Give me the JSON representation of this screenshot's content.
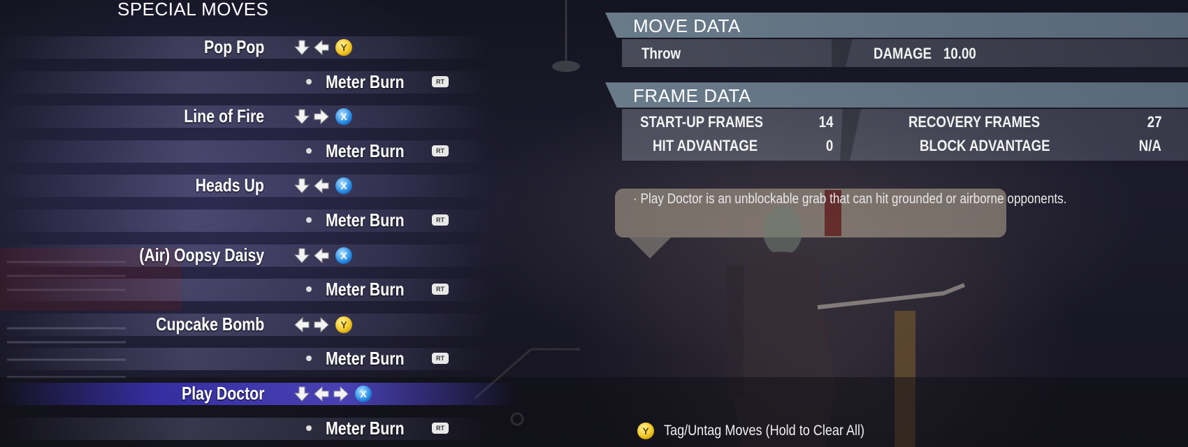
{
  "moves_list": {
    "title": "SPECIAL MOVES",
    "rows": [
      {
        "type": "move",
        "name": "Pop Pop",
        "inputs": [
          "down",
          "back"
        ],
        "button": {
          "label": "Y",
          "color": "#f0c420"
        },
        "selected": false
      },
      {
        "type": "meter",
        "label": "Meter Burn",
        "trigger": "RT"
      },
      {
        "type": "move",
        "name": "Line of Fire",
        "inputs": [
          "down",
          "forward"
        ],
        "button": {
          "label": "X",
          "color": "#2a8ee8"
        },
        "selected": false
      },
      {
        "type": "meter",
        "label": "Meter Burn",
        "trigger": "RT"
      },
      {
        "type": "move",
        "name": "Heads Up",
        "inputs": [
          "down",
          "back"
        ],
        "button": {
          "label": "X",
          "color": "#2a8ee8"
        },
        "selected": false
      },
      {
        "type": "meter",
        "label": "Meter Burn",
        "trigger": "RT"
      },
      {
        "type": "move",
        "name": "(Air) Oopsy Daisy",
        "inputs": [
          "down",
          "back"
        ],
        "button": {
          "label": "X",
          "color": "#2a8ee8"
        },
        "selected": false
      },
      {
        "type": "meter",
        "label": "Meter Burn",
        "trigger": "RT"
      },
      {
        "type": "move",
        "name": "Cupcake Bomb",
        "inputs": [
          "back",
          "forward"
        ],
        "button": {
          "label": "Y",
          "color": "#f0c420"
        },
        "selected": false
      },
      {
        "type": "meter",
        "label": "Meter Burn",
        "trigger": "RT"
      },
      {
        "type": "move",
        "name": "Play Doctor",
        "inputs": [
          "down",
          "back",
          "forward"
        ],
        "button": {
          "label": "X",
          "color": "#2a8ee8"
        },
        "selected": true
      },
      {
        "type": "meter",
        "label": "Meter Burn",
        "trigger": "RT"
      }
    ]
  },
  "move_data": {
    "title": "MOVE DATA",
    "type": "Throw",
    "damage_label": "DAMAGE",
    "damage_value": "10.00"
  },
  "frame_data": {
    "title": "FRAME DATA",
    "startup_label": "START-UP FRAMES",
    "startup_value": "14",
    "recovery_label": "RECOVERY FRAMES",
    "recovery_value": "27",
    "hit_adv_label": "HIT ADVANTAGE",
    "hit_adv_value": "0",
    "block_adv_label": "BLOCK ADVANTAGE",
    "block_adv_value": "N/A"
  },
  "note": "· Play Doctor is an unblockable grab that can hit grounded or airborne opponents.",
  "footer": {
    "button": {
      "label": "Y",
      "color": "#f0c420"
    },
    "label": "Tag/Untag Moves (Hold to Clear All)"
  }
}
